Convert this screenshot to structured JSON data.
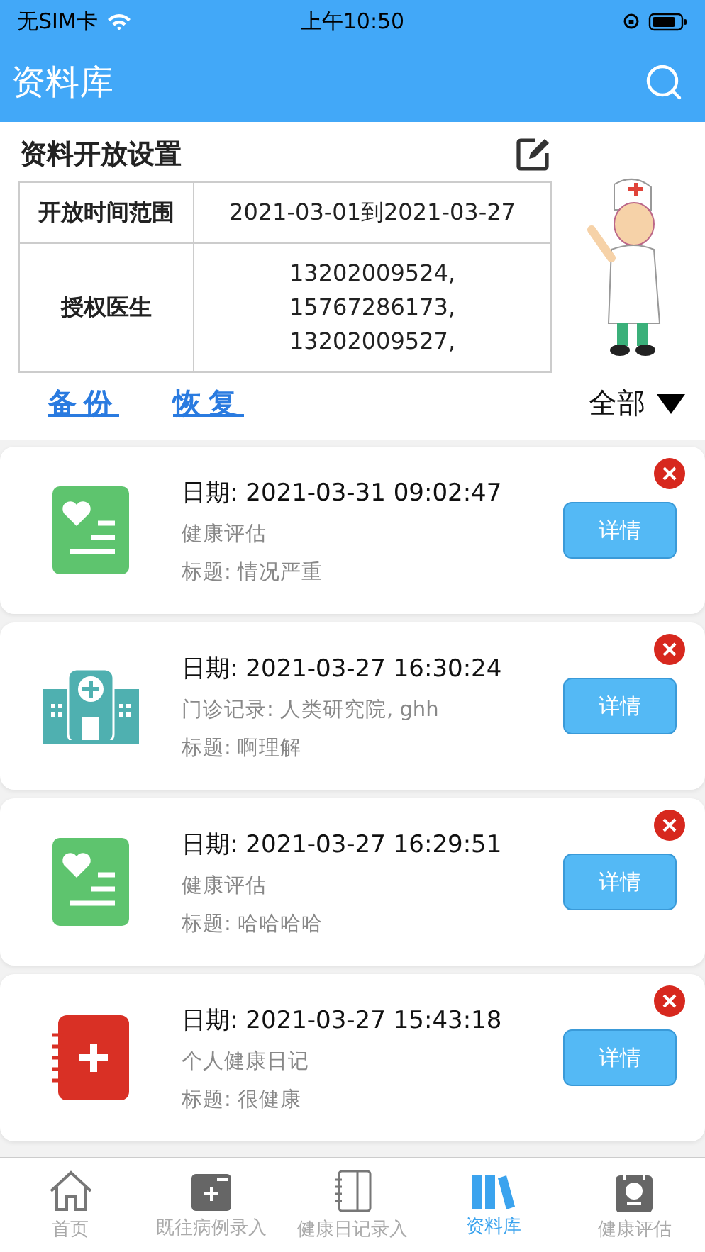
{
  "status_bar": {
    "carrier": "无SIM卡",
    "time": "上午10:50"
  },
  "header": {
    "title": "资料库"
  },
  "settings": {
    "title": "资料开放设置",
    "rows": [
      {
        "label": "开放时间范围",
        "values": [
          "2021-03-01到2021-03-27"
        ]
      },
      {
        "label": "授权医生",
        "values": [
          "13202009524,",
          "15767286173,",
          "13202009527,"
        ]
      }
    ]
  },
  "actions": {
    "links": [
      "备份",
      "恢复"
    ],
    "filter": "全部"
  },
  "records": [
    {
      "kind": "assessment",
      "date": "日期: 2021-03-31 09:02:47",
      "type": "健康评估",
      "title": "标题: 情况严重",
      "button": "详情"
    },
    {
      "kind": "clinic",
      "date": "日期: 2021-03-27 16:30:24",
      "type": "门诊记录: 人类研究院, ghh",
      "title": "标题: 啊理解",
      "button": "详情"
    },
    {
      "kind": "assessment",
      "date": "日期: 2021-03-27 16:29:51",
      "type": "健康评估",
      "title": "标题: 哈哈哈哈",
      "button": "详情"
    },
    {
      "kind": "diary",
      "date": "日期: 2021-03-27 15:43:18",
      "type": "个人健康日记",
      "title": "标题: 很健康",
      "button": "详情"
    }
  ],
  "tabs": [
    {
      "kind": "home",
      "label": "首页",
      "selected": false
    },
    {
      "kind": "case",
      "label": "既往病例录入",
      "selected": false
    },
    {
      "kind": "diary",
      "label": "健康日记录入",
      "selected": false
    },
    {
      "kind": "library",
      "label": "资料库",
      "selected": true
    },
    {
      "kind": "assess",
      "label": "健康评估",
      "selected": false
    }
  ]
}
